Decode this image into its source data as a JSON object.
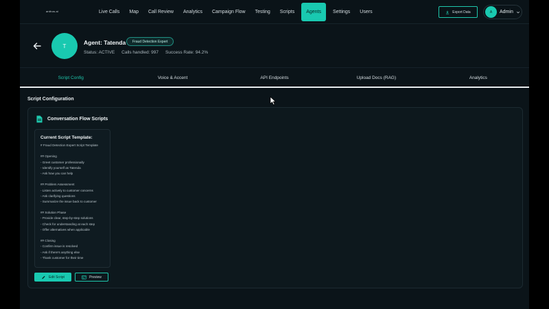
{
  "app": {
    "logo": "anthos.ai"
  },
  "nav": {
    "items": [
      {
        "label": "Live Calls"
      },
      {
        "label": "Map"
      },
      {
        "label": "Call Review"
      },
      {
        "label": "Analytics"
      },
      {
        "label": "Campaign Flow"
      },
      {
        "label": "Testing"
      },
      {
        "label": "Scripts"
      },
      {
        "label": "Agents",
        "active": true
      },
      {
        "label": "Settings"
      },
      {
        "label": "Users"
      }
    ],
    "export_label": "Export Data",
    "export_icon": "download-icon",
    "user": {
      "initial": "A",
      "name": "Admin",
      "menu_icon": "chevron-down-icon"
    }
  },
  "agent": {
    "back_icon": "arrow-left-icon",
    "initial": "T",
    "title": "Agent: Tatenda",
    "badge": "Fraud Detection Expert",
    "status": "Status: ACTIVE",
    "calls": "Calls handled: 997",
    "success": "Success Rate: 94.2%"
  },
  "tabs": [
    {
      "label": "Script Config",
      "active": true
    },
    {
      "label": "Voice & Accent"
    },
    {
      "label": "API Endpoints"
    },
    {
      "label": "Upload Docs (RAG)"
    },
    {
      "label": "Analytics"
    }
  ],
  "section": {
    "title": "Script Configuration"
  },
  "card": {
    "icon": "document-icon",
    "title": "Conversation Flow Scripts",
    "template_heading": "Current Script Template:",
    "template_lines": [
      "# Fraud Detection Expert Script Template",
      "",
      "## Opening",
      "- Greet customer professionally",
      "- Identify yourself as Tatenda",
      "- Ask how you can help",
      "",
      "## Problem Assessment",
      "- Listen actively to customer concerns",
      "- Ask clarifying questions",
      "- Summarize the issue back to customer",
      "",
      "## Solution Phase",
      "- Provide clear, step-by-step solutions",
      "- Check for understanding at each step",
      "- Offer alternatives when applicable",
      "",
      "## Closing",
      "- Confirm issue is resolved",
      "- Ask if there's anything else",
      "- Thank customer for their time"
    ],
    "edit_label": "Edit Script",
    "edit_icon": "pencil-icon",
    "preview_label": "Preview",
    "preview_icon": "preview-icon"
  },
  "colors": {
    "accent": "#19c9b0",
    "background": "#0b1419",
    "card": "#0d181d"
  }
}
